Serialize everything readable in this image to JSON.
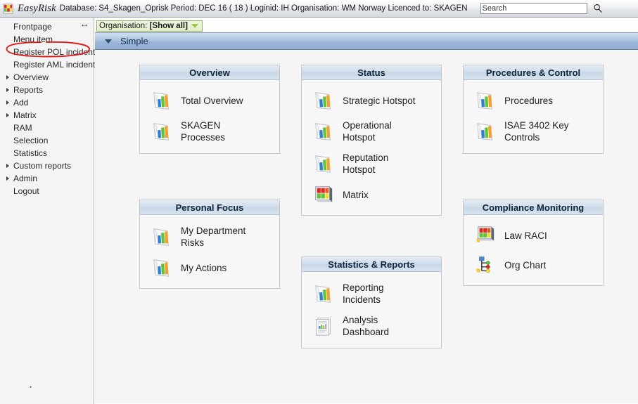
{
  "topbar": {
    "favicon_name": "easyrisk-logo-icon",
    "brand": "EasyRisk",
    "info": "Database: S4_Skagen_Oprisk Period: DEC 16 ( 18 ) Loginid: IH Organisation: WM Norway Licenced to: SKAGEN",
    "search_placeholder": "Search",
    "search_value": "",
    "search_icon_name": "search-icon"
  },
  "sidebar": {
    "expander_label": "↔",
    "items": [
      {
        "label": "Frontpage",
        "has_arrow": false
      },
      {
        "label": "Menu item",
        "has_arrow": false
      },
      {
        "label": "Register POL incident",
        "has_arrow": false
      },
      {
        "label": "Register AML incident",
        "has_arrow": false
      },
      {
        "label": "Overview",
        "has_arrow": true
      },
      {
        "label": "Reports",
        "has_arrow": true
      },
      {
        "label": "Add",
        "has_arrow": true
      },
      {
        "label": "Matrix",
        "has_arrow": true
      },
      {
        "label": "RAM",
        "has_arrow": false
      },
      {
        "label": "Selection",
        "has_arrow": false
      },
      {
        "label": "Statistics",
        "has_arrow": false
      },
      {
        "label": "Custom reports",
        "has_arrow": true
      },
      {
        "label": "Admin",
        "has_arrow": true
      },
      {
        "label": "Logout",
        "has_arrow": false
      }
    ],
    "annotation_target": "Register POL incident",
    "annotation_color": "#e01b1b",
    "dot": "•"
  },
  "content": {
    "org_tab": {
      "prefix": "Organisation: ",
      "value": "[Show all]"
    },
    "section_bar": {
      "label": "Simple"
    }
  },
  "panels": [
    {
      "id": "overview",
      "title": "Overview",
      "tiles": [
        {
          "name": "total-overview",
          "icon": "bar-chart-icon",
          "lines": [
            "Total Overview"
          ]
        },
        {
          "name": "skagen-processes",
          "icon": "bar-chart-icon",
          "lines": [
            "SKAGEN",
            "Processes"
          ]
        }
      ]
    },
    {
      "id": "personal-focus",
      "title": "Personal Focus",
      "tiles": [
        {
          "name": "my-department-risks",
          "icon": "bar-chart-icon",
          "lines": [
            "My Department",
            "Risks"
          ]
        },
        {
          "name": "my-actions",
          "icon": "bar-chart-icon",
          "lines": [
            "My Actions"
          ]
        }
      ]
    },
    {
      "id": "status",
      "title": "Status",
      "tiles": [
        {
          "name": "strategic-hotspot",
          "icon": "bar-chart-icon",
          "lines": [
            "Strategic Hotspot"
          ]
        },
        {
          "name": "operational-hotspot",
          "icon": "bar-chart-icon",
          "lines": [
            "Operational",
            "Hotspot"
          ]
        },
        {
          "name": "reputation-hotspot",
          "icon": "bar-chart-icon",
          "lines": [
            "Reputation",
            "Hotspot"
          ]
        },
        {
          "name": "matrix",
          "icon": "matrix-grid-icon",
          "lines": [
            "Matrix"
          ]
        }
      ]
    },
    {
      "id": "statistics-reports",
      "title": "Statistics & Reports",
      "tiles": [
        {
          "name": "reporting-incidents",
          "icon": "bar-chart-icon",
          "lines": [
            "Reporting",
            "Incidents"
          ]
        },
        {
          "name": "analysis-dashboard",
          "icon": "report-document-icon",
          "lines": [
            "Analysis",
            "Dashboard"
          ]
        }
      ]
    },
    {
      "id": "procedures-control",
      "title": "Procedures & Control",
      "tiles": [
        {
          "name": "procedures",
          "icon": "bar-chart-icon",
          "lines": [
            "Procedures"
          ]
        },
        {
          "name": "isae-3402-key-controls",
          "icon": "bar-chart-icon",
          "lines": [
            "ISAE 3402 Key",
            "Controls"
          ]
        }
      ]
    },
    {
      "id": "compliance-monitoring",
      "title": "Compliance Monitoring",
      "tiles": [
        {
          "name": "law-raci",
          "icon": "matrix-grid-icon",
          "lines": [
            "Law RACI"
          ]
        },
        {
          "name": "org-chart",
          "icon": "org-chart-icon",
          "lines": [
            "Org Chart"
          ]
        }
      ]
    }
  ],
  "colors": {
    "accent_green": "#8fae5a",
    "bar_blue": "#2e7fd4",
    "bar_green": "#5cb85c",
    "bar_orange": "#f0a22e",
    "matrix_red": "#e02a20",
    "matrix_yellow": "#f2dd2a",
    "matrix_green": "#62c23a",
    "annotation_red": "#e01b1b"
  }
}
